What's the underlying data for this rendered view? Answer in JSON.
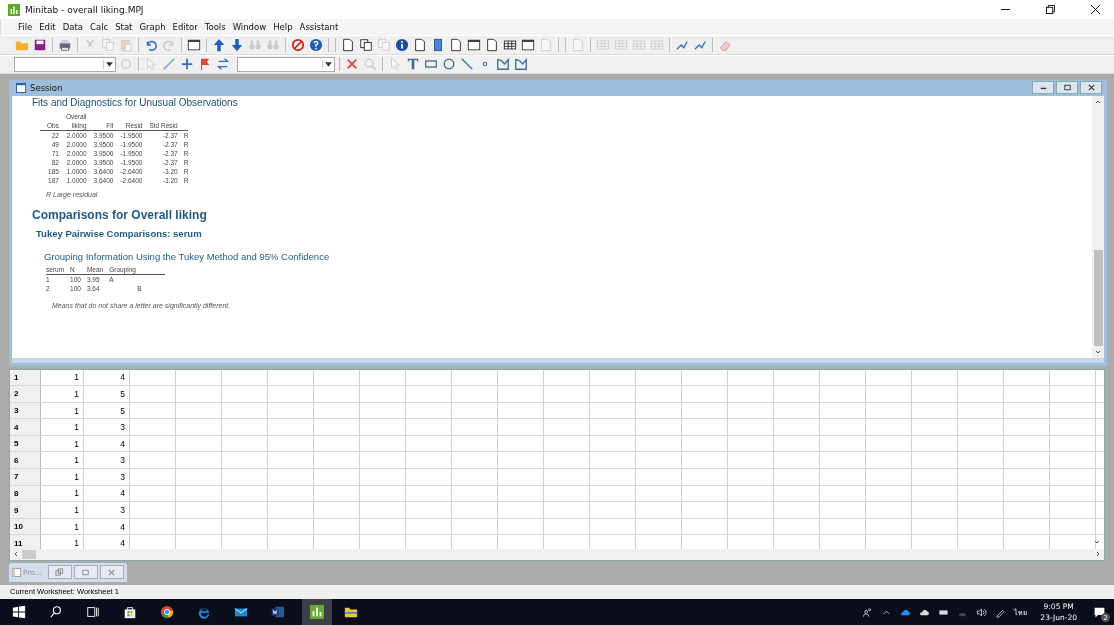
{
  "window": {
    "title": "Minitab - overall liking.MPJ"
  },
  "menu": [
    "File",
    "Edit",
    "Data",
    "Calc",
    "Stat",
    "Graph",
    "Editor",
    "Tools",
    "Window",
    "Help",
    "Assistant"
  ],
  "session": {
    "title": "Session",
    "partial_heading": "Fits and Diagnostics for Unusual Observations",
    "fits_table": {
      "columns": [
        {
          "label": "Obs"
        },
        {
          "top": "Overall",
          "label": "liking"
        },
        {
          "label": "Fit"
        },
        {
          "label": "Resid"
        },
        {
          "label": "Std Resid"
        },
        {}
      ],
      "rows": [
        [
          "22",
          "2.0000",
          "3.9500",
          "-1.9500",
          "-2.37",
          "R"
        ],
        [
          "49",
          "2.0000",
          "3.9500",
          "-1.9500",
          "-2.37",
          "R"
        ],
        [
          "71",
          "2.0000",
          "3.9500",
          "-1.9500",
          "-2.37",
          "R"
        ],
        [
          "82",
          "2.0000",
          "3.9500",
          "-1.9500",
          "-2.37",
          "R"
        ],
        [
          "185",
          "1.0000",
          "3.6400",
          "-2.6400",
          "-3.20",
          "R"
        ],
        [
          "187",
          "1.0000",
          "3.6400",
          "-2.6400",
          "-3.20",
          "R"
        ]
      ]
    },
    "fits_note": "R  Large residual",
    "comparisons_heading": "Comparisons for Overall liking",
    "tukey_heading": "Tukey Pairwise Comparisons: serum",
    "grouping_heading": "Grouping Information Using the Tukey Method and 95% Confidence",
    "grouping_table": {
      "columns": [
        "serum",
        "N",
        "Mean",
        "Grouping"
      ],
      "rows": [
        {
          "cells": [
            "1",
            "100",
            "3.95"
          ],
          "grouping_1": "A"
        },
        {
          "cells": [
            "2",
            "100",
            "3.64"
          ],
          "grouping_2": "B"
        }
      ]
    },
    "grouping_note": "Means that do not share a letter are significantly different."
  },
  "worksheet": {
    "rows": [
      [
        "1",
        "1",
        "4"
      ],
      [
        "2",
        "1",
        "5"
      ],
      [
        "3",
        "1",
        "5"
      ],
      [
        "4",
        "1",
        "3"
      ],
      [
        "5",
        "1",
        "4"
      ],
      [
        "6",
        "1",
        "3"
      ],
      [
        "7",
        "1",
        "3"
      ],
      [
        "8",
        "1",
        "4"
      ],
      [
        "9",
        "1",
        "3"
      ],
      [
        "10",
        "1",
        "4"
      ],
      [
        "11",
        "1",
        "4"
      ]
    ]
  },
  "minimized_window": {
    "title": "Pro..."
  },
  "status_bar": "Current Worksheet: Worksheet 1",
  "taskbar": {
    "language": "ไทย",
    "time": "9:05 PM",
    "date": "23-Jun-20",
    "notifications": "2"
  }
}
